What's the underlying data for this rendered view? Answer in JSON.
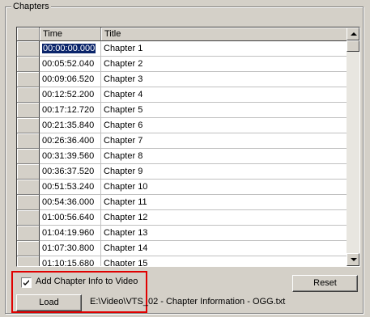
{
  "group": {
    "title": "Chapters"
  },
  "table": {
    "columns": [
      "Time",
      "Title"
    ],
    "rows": [
      {
        "time": "00:00:00.000",
        "title": "Chapter 1"
      },
      {
        "time": "00:05:52.040",
        "title": "Chapter 2"
      },
      {
        "time": "00:09:06.520",
        "title": "Chapter 3"
      },
      {
        "time": "00:12:52.200",
        "title": "Chapter 4"
      },
      {
        "time": "00:17:12.720",
        "title": "Chapter 5"
      },
      {
        "time": "00:21:35.840",
        "title": "Chapter 6"
      },
      {
        "time": "00:26:36.400",
        "title": "Chapter 7"
      },
      {
        "time": "00:31:39.560",
        "title": "Chapter 8"
      },
      {
        "time": "00:36:37.520",
        "title": "Chapter 9"
      },
      {
        "time": "00:51:53.240",
        "title": "Chapter 10"
      },
      {
        "time": "00:54:36.000",
        "title": "Chapter 11"
      },
      {
        "time": "01:00:56.640",
        "title": "Chapter 12"
      },
      {
        "time": "01:04:19.960",
        "title": "Chapter 13"
      },
      {
        "time": "01:07:30.800",
        "title": "Chapter 14"
      },
      {
        "time": "01:10:15.680",
        "title": "Chapter 15"
      }
    ]
  },
  "controls": {
    "checkbox_label": "Add Chapter Info to Video",
    "checkbox_checked": true,
    "reset_label": "Reset",
    "load_label": "Load",
    "file_path": "E:\\Video\\VTS_02 - Chapter Information - OGG.txt"
  },
  "colors": {
    "selection": "#0a246a",
    "highlight_box": "#e00000"
  }
}
